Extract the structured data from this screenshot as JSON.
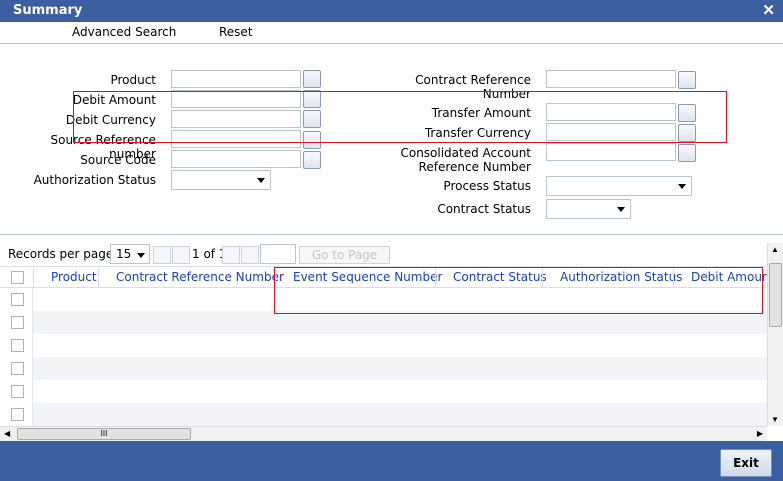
{
  "window": {
    "title": "Summary",
    "close_glyph": "✕"
  },
  "actions": {
    "advanced_search": "Advanced Search",
    "reset": "Reset"
  },
  "form": {
    "product": "Product",
    "debit_amount": "Debit Amount",
    "debit_currency": "Debit Currency",
    "source_reference_number": "Source Reference number",
    "source_code": "Source Code",
    "authorization_status": "Authorization Status",
    "contract_reference_1": "Contract Reference",
    "contract_reference_2": "Number",
    "transfer_amount": "Transfer Amount",
    "transfer_currency": "Transfer Currency",
    "consolidated_account_1": "Consolidated Account",
    "consolidated_account_2": "Reference Number",
    "process_status": "Process Status",
    "contract_status": "Contract Status"
  },
  "pager": {
    "records_per_page_label": "Records per page",
    "records_per_page_value": "15",
    "page_of": "1 of 1",
    "go_to_page": "Go to Page"
  },
  "grid": {
    "columns": [
      "Product",
      "Contract Reference Number",
      "Event Sequence Number",
      "Contract Status",
      "Authorization Status",
      "Debit Amount"
    ]
  },
  "hscroll": {
    "thumb_grip": "III"
  },
  "footer": {
    "exit": "Exit"
  },
  "colors": {
    "header_blue": "#3b5fa0",
    "column_link": "#1a3fc9",
    "highlight_red": "#d9141b"
  },
  "icons": [
    "close-icon",
    "lov-button-icon",
    "dropdown-arrow-icon",
    "scroll-arrow-icon"
  ]
}
